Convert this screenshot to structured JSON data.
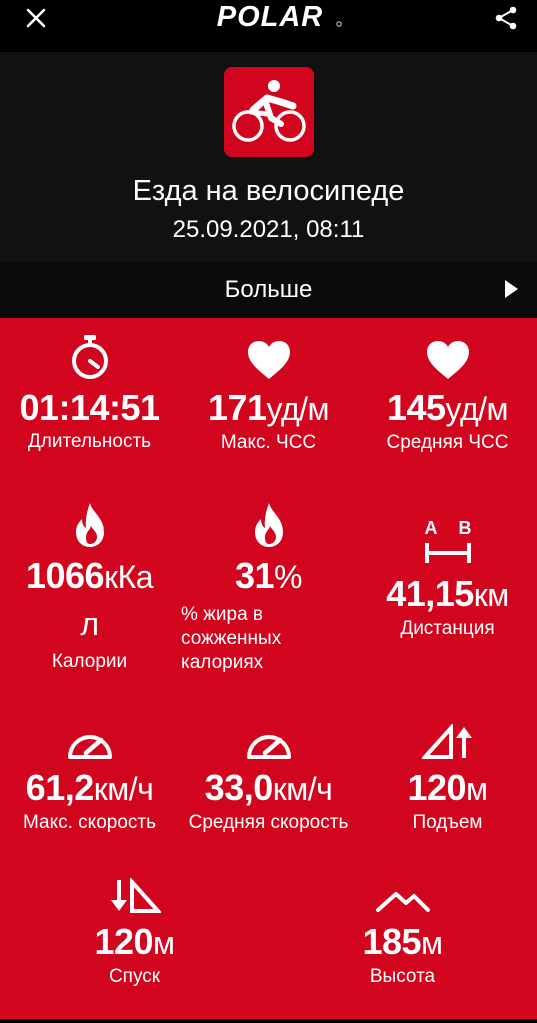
{
  "topbar": {
    "close_icon": "close-icon",
    "logo": "POLAR",
    "share_icon": "share-icon"
  },
  "header": {
    "sport_icon": "cycling-icon",
    "title": "Езда на велосипеде",
    "date": "25.09.2021, 08:11"
  },
  "more": {
    "label": "Больше",
    "icon": "play-arrow-icon"
  },
  "colors": {
    "accent": "#d2051e",
    "background": "#000000",
    "header": "#111111"
  },
  "stats": {
    "duration": {
      "value": "01:14:51",
      "unit": "",
      "label": "Длительность",
      "icon": "stopwatch-icon"
    },
    "max_hr": {
      "value": "171",
      "unit": "уд/м",
      "label": "Макс. ЧСС",
      "icon": "heart-icon"
    },
    "avg_hr": {
      "value": "145",
      "unit": "уд/м",
      "label": "Средняя ЧСС",
      "icon": "heart-icon"
    },
    "calories": {
      "value": "1066",
      "unit": "кКа",
      "unit_wrap": "л",
      "label": "Калории",
      "icon": "flame-icon"
    },
    "fat": {
      "value": "31",
      "unit": "%",
      "label_lines": [
        "% жира в",
        "сожженных",
        "калориях"
      ],
      "icon": "flame-icon"
    },
    "distance": {
      "value": "41,15",
      "unit": "км",
      "label": "Дистанция",
      "icon": "distance-ab-icon",
      "icon_a": "A",
      "icon_b": "B"
    },
    "max_speed": {
      "value": "61,2",
      "unit": "км/ч",
      "label": "Макс. скорость",
      "icon": "speedometer-icon"
    },
    "avg_speed": {
      "value": "33,0",
      "unit": "км/ч",
      "label": "Средняя скорость",
      "icon": "speedometer-icon"
    },
    "ascent": {
      "value": "120",
      "unit": "м",
      "label": "Подъем",
      "icon": "ascent-icon"
    },
    "descent": {
      "value": "120",
      "unit": "м",
      "label": "Спуск",
      "icon": "descent-icon"
    },
    "altitude": {
      "value": "185",
      "unit": "м",
      "label": "Высота",
      "icon": "mountain-icon"
    }
  }
}
